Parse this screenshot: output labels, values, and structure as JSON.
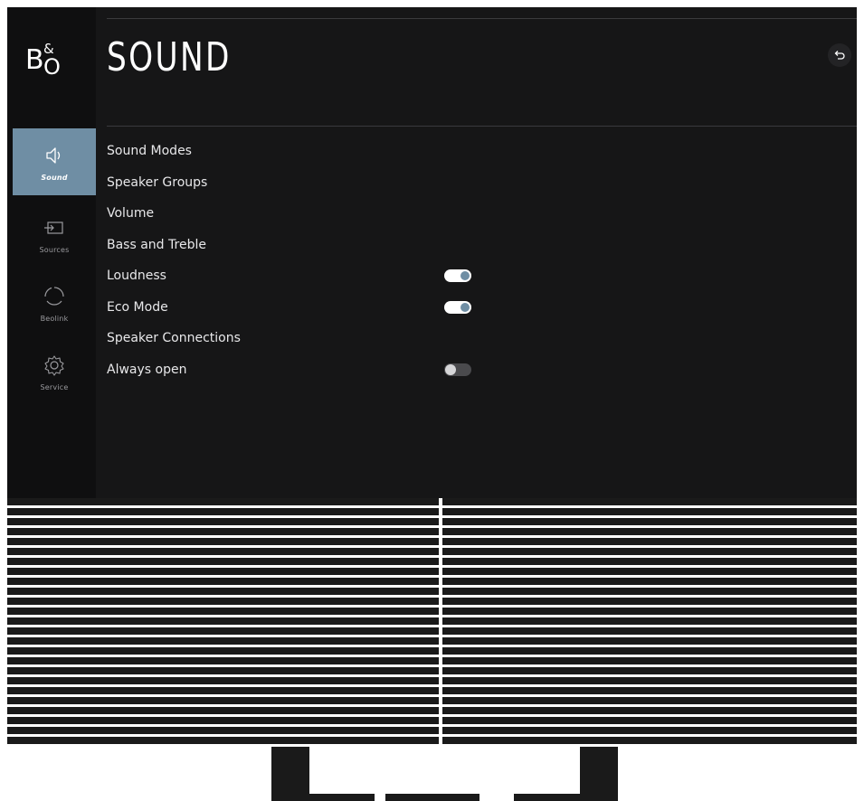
{
  "brand": {
    "logo_text": "B&O"
  },
  "sidebar": {
    "items": [
      {
        "label": "Sound",
        "icon": "speaker-icon",
        "active": true
      },
      {
        "label": "Sources",
        "icon": "input-icon",
        "active": false
      },
      {
        "label": "Beolink",
        "icon": "beolink-icon",
        "active": false
      },
      {
        "label": "Service",
        "icon": "gear-icon",
        "active": false
      }
    ]
  },
  "header": {
    "title": "SOUND",
    "back_icon": "back-arrow-icon"
  },
  "menu": {
    "items": [
      {
        "label": "Sound Modes"
      },
      {
        "label": "Speaker Groups"
      },
      {
        "label": "Volume"
      },
      {
        "label": "Bass and Treble"
      },
      {
        "label": "Loudness",
        "toggle": "on"
      },
      {
        "label": "Eco Mode",
        "toggle": "on"
      },
      {
        "label": "Speaker Connections"
      },
      {
        "label": "Always open",
        "toggle": "off"
      }
    ]
  },
  "colors": {
    "accent": "#6f8ea4",
    "screen_bg": "#161617",
    "sidebar_bg": "#0f0f10",
    "text": "#e8e8ea"
  }
}
